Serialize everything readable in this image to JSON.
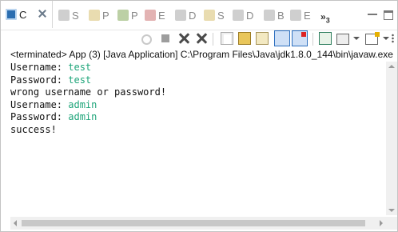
{
  "tabs": [
    {
      "label": "C",
      "icon": "console-icon",
      "active": true
    },
    {
      "label": "S",
      "icon": "search-icon"
    },
    {
      "label": "P",
      "icon": "problems-icon"
    },
    {
      "label": "P",
      "icon": "progress-icon"
    },
    {
      "label": "E",
      "icon": "error-log-icon"
    },
    {
      "label": "D",
      "icon": "javadoc-icon"
    },
    {
      "label": "S",
      "icon": "servers-icon"
    },
    {
      "label": "D",
      "icon": "data-source-icon"
    },
    {
      "label": "B",
      "icon": "breakpoints-icon"
    },
    {
      "label": "E",
      "icon": "expressions-icon"
    }
  ],
  "overflow": {
    "label": "»",
    "count": "3"
  },
  "header": "<terminated> App (3) [Java Application] C:\\Program Files\\Java\\jdk1.8.0_144\\bin\\javaw.exe (",
  "console_lines": [
    {
      "segments": [
        {
          "text": "Username: ",
          "kind": "out"
        },
        {
          "text": "test",
          "kind": "in"
        }
      ]
    },
    {
      "segments": [
        {
          "text": "Password: ",
          "kind": "out"
        },
        {
          "text": "test",
          "kind": "in"
        }
      ]
    },
    {
      "segments": [
        {
          "text": "wrong username or password!",
          "kind": "out"
        }
      ]
    },
    {
      "segments": [
        {
          "text": "Username: ",
          "kind": "out"
        },
        {
          "text": "admin",
          "kind": "in"
        }
      ]
    },
    {
      "segments": [
        {
          "text": "Password: ",
          "kind": "out"
        },
        {
          "text": "admin",
          "kind": "in"
        }
      ]
    },
    {
      "segments": [
        {
          "text": "success!",
          "kind": "out"
        }
      ]
    }
  ],
  "colors": {
    "stdout": "#111111",
    "stdin": "#1fa57a"
  }
}
